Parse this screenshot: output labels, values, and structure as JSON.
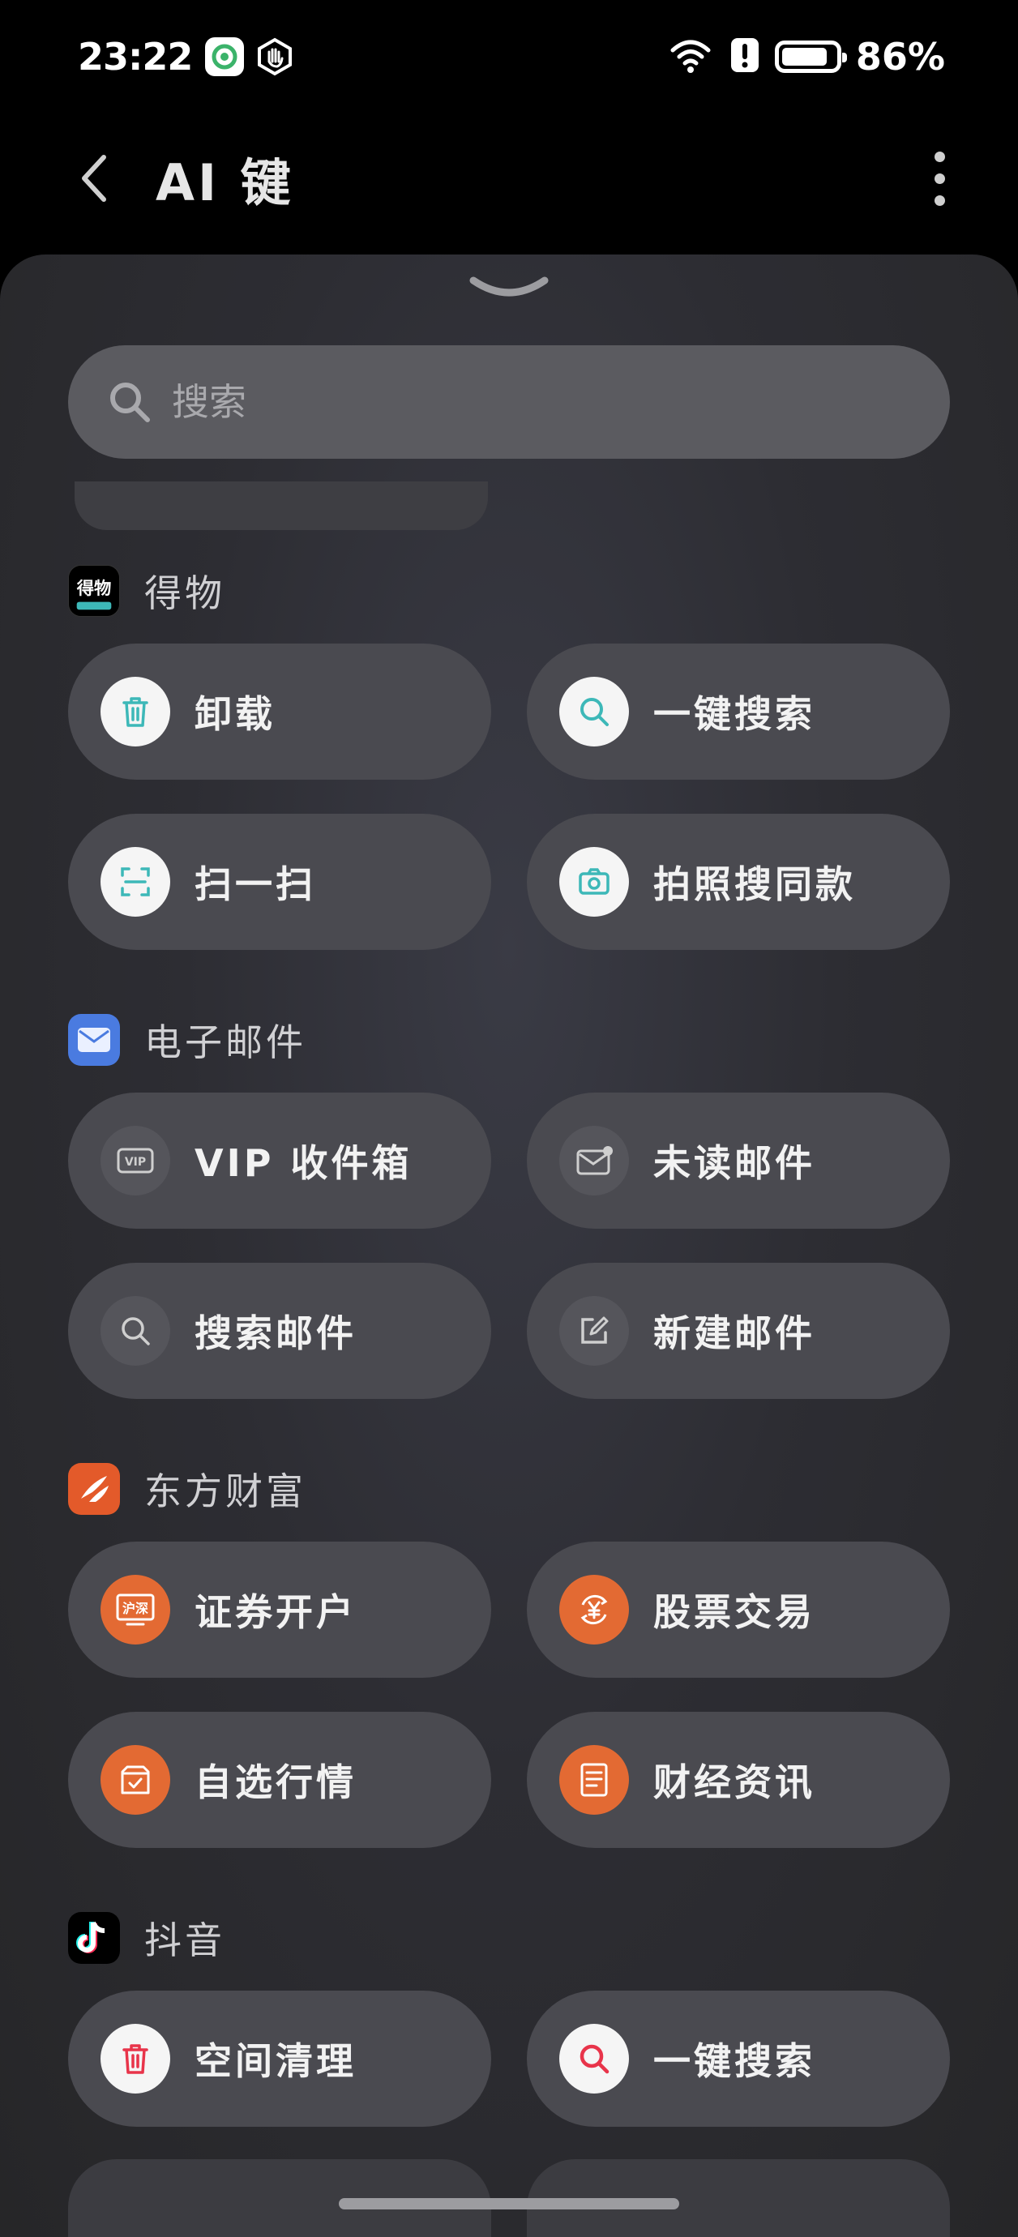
{
  "status": {
    "time": "23:22",
    "battery": "86%",
    "battery_level": 0.86,
    "icons": [
      "wechat-icon",
      "hand-icon",
      "wifi-icon",
      "alert-icon",
      "battery-icon"
    ]
  },
  "header": {
    "title": "AI 键"
  },
  "search": {
    "placeholder": "搜索"
  },
  "sections": [
    {
      "app": "得物",
      "actions": [
        {
          "label": "卸载",
          "icon": "trash-icon"
        },
        {
          "label": "一键搜索",
          "icon": "search-icon"
        },
        {
          "label": "扫一扫",
          "icon": "scan-icon"
        },
        {
          "label": "拍照搜同款",
          "icon": "camera-icon"
        }
      ]
    },
    {
      "app": "电子邮件",
      "actions": [
        {
          "label": "VIP 收件箱",
          "icon": "vip-icon"
        },
        {
          "label": "未读邮件",
          "icon": "mail-unread-icon"
        },
        {
          "label": "搜索邮件",
          "icon": "search-icon"
        },
        {
          "label": "新建邮件",
          "icon": "compose-icon"
        }
      ]
    },
    {
      "app": "东方财富",
      "actions": [
        {
          "label": "证券开户",
          "icon": "securities-icon"
        },
        {
          "label": "股票交易",
          "icon": "yuan-exchange-icon"
        },
        {
          "label": "自选行情",
          "icon": "watchlist-icon"
        },
        {
          "label": "财经资讯",
          "icon": "news-icon"
        }
      ]
    },
    {
      "app": "抖音",
      "actions": [
        {
          "label": "空间清理",
          "icon": "trash-icon"
        },
        {
          "label": "一键搜索",
          "icon": "search-icon"
        }
      ]
    }
  ],
  "colors": {
    "accent_teal": "#3db8b8",
    "accent_orange": "#e36a33",
    "tiktok_red": "#e8344a",
    "mail_blue": "#4a7be0"
  }
}
